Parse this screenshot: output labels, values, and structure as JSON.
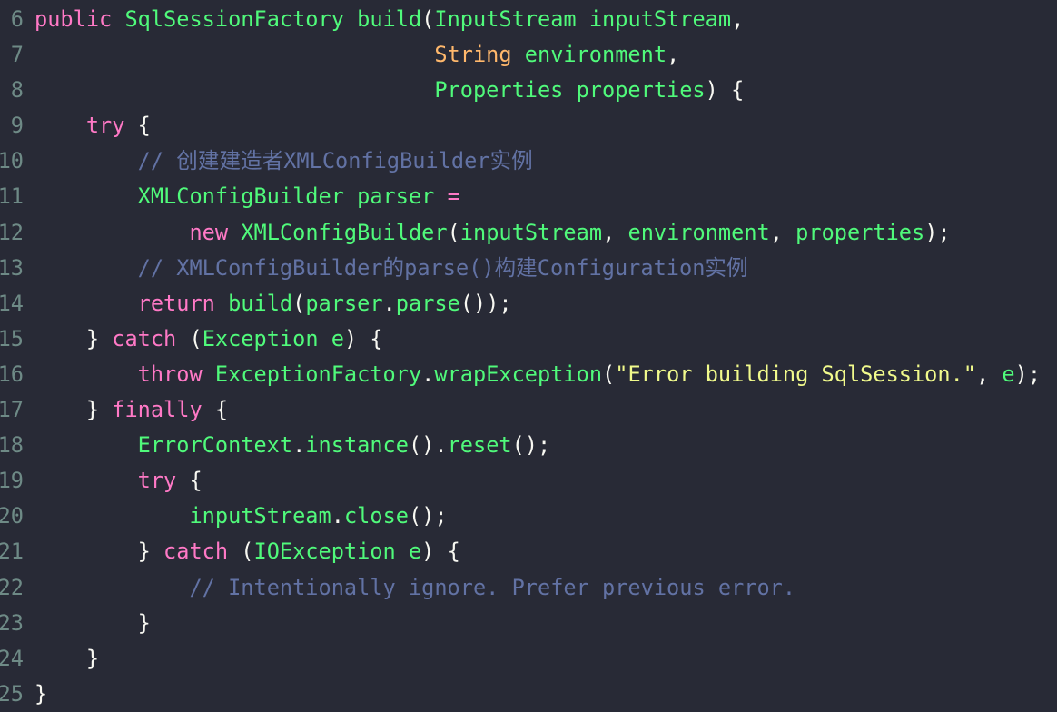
{
  "theme": {
    "background": "#282a36",
    "keyword": "#ff79c6",
    "identifier": "#50fa7b",
    "type": "#ffb86c",
    "comment": "#6272a4",
    "string": "#f1fa8c",
    "punctuation": "#f8f8f2",
    "line_number": "#6e8a86"
  },
  "lines": [
    {
      "n": "6",
      "t": [
        [
          "k",
          "public "
        ],
        [
          "g",
          "SqlSessionFactory build"
        ],
        [
          "p",
          "("
        ],
        [
          "g",
          "InputStream inputStream"
        ],
        [
          "p",
          ","
        ]
      ]
    },
    {
      "n": "7",
      "t": [
        [
          "p",
          "                               "
        ],
        [
          "o",
          "String "
        ],
        [
          "g",
          "environment"
        ],
        [
          "p",
          ","
        ]
      ]
    },
    {
      "n": "8",
      "t": [
        [
          "p",
          "                               "
        ],
        [
          "g",
          "Properties properties"
        ],
        [
          "p",
          ") {"
        ]
      ]
    },
    {
      "n": "9",
      "t": [
        [
          "p",
          "    "
        ],
        [
          "k",
          "try"
        ],
        [
          "p",
          " {"
        ]
      ]
    },
    {
      "n": "10",
      "t": [
        [
          "p",
          "        "
        ],
        [
          "c",
          "// 创建建造者XMLConfigBuilder实例"
        ]
      ]
    },
    {
      "n": "11",
      "t": [
        [
          "p",
          "        "
        ],
        [
          "g",
          "XMLConfigBuilder parser "
        ],
        [
          "k",
          "="
        ]
      ]
    },
    {
      "n": "12",
      "t": [
        [
          "p",
          "            "
        ],
        [
          "k",
          "new "
        ],
        [
          "g",
          "XMLConfigBuilder"
        ],
        [
          "p",
          "("
        ],
        [
          "g",
          "inputStream"
        ],
        [
          "p",
          ", "
        ],
        [
          "g",
          "environment"
        ],
        [
          "p",
          ", "
        ],
        [
          "g",
          "properties"
        ],
        [
          "p",
          ");"
        ]
      ]
    },
    {
      "n": "13",
      "t": [
        [
          "p",
          "        "
        ],
        [
          "c",
          "// XMLConfigBuilder的parse()构建Configuration实例"
        ]
      ]
    },
    {
      "n": "14",
      "t": [
        [
          "p",
          "        "
        ],
        [
          "k",
          "return "
        ],
        [
          "g",
          "build"
        ],
        [
          "p",
          "("
        ],
        [
          "g",
          "parser"
        ],
        [
          "p",
          "."
        ],
        [
          "g",
          "parse"
        ],
        [
          "p",
          "());"
        ]
      ]
    },
    {
      "n": "15",
      "t": [
        [
          "p",
          "    } "
        ],
        [
          "k",
          "catch"
        ],
        [
          "p",
          " ("
        ],
        [
          "g",
          "Exception e"
        ],
        [
          "p",
          ") {"
        ]
      ]
    },
    {
      "n": "16",
      "t": [
        [
          "p",
          "        "
        ],
        [
          "k",
          "throw "
        ],
        [
          "g",
          "ExceptionFactory"
        ],
        [
          "p",
          "."
        ],
        [
          "g",
          "wrapException"
        ],
        [
          "p",
          "("
        ],
        [
          "s",
          "\"Error building SqlSession.\""
        ],
        [
          "p",
          ", "
        ],
        [
          "g",
          "e"
        ],
        [
          "p",
          ");"
        ]
      ]
    },
    {
      "n": "17",
      "t": [
        [
          "p",
          "    } "
        ],
        [
          "k",
          "finally"
        ],
        [
          "p",
          " {"
        ]
      ]
    },
    {
      "n": "18",
      "t": [
        [
          "p",
          "        "
        ],
        [
          "g",
          "ErrorContext"
        ],
        [
          "p",
          "."
        ],
        [
          "g",
          "instance"
        ],
        [
          "p",
          "()."
        ],
        [
          "g",
          "reset"
        ],
        [
          "p",
          "();"
        ]
      ]
    },
    {
      "n": "19",
      "t": [
        [
          "p",
          "        "
        ],
        [
          "k",
          "try"
        ],
        [
          "p",
          " {"
        ]
      ]
    },
    {
      "n": "20",
      "t": [
        [
          "p",
          "            "
        ],
        [
          "g",
          "inputStream"
        ],
        [
          "p",
          "."
        ],
        [
          "g",
          "close"
        ],
        [
          "p",
          "();"
        ]
      ]
    },
    {
      "n": "21",
      "t": [
        [
          "p",
          "        } "
        ],
        [
          "k",
          "catch"
        ],
        [
          "p",
          " ("
        ],
        [
          "g",
          "IOException e"
        ],
        [
          "p",
          ") {"
        ]
      ]
    },
    {
      "n": "22",
      "t": [
        [
          "p",
          "            "
        ],
        [
          "c",
          "// Intentionally ignore. Prefer previous error."
        ]
      ]
    },
    {
      "n": "23",
      "t": [
        [
          "p",
          "        }"
        ]
      ]
    },
    {
      "n": "24",
      "t": [
        [
          "p",
          "    }"
        ]
      ]
    },
    {
      "n": "25",
      "t": [
        [
          "p",
          "}"
        ]
      ]
    }
  ]
}
